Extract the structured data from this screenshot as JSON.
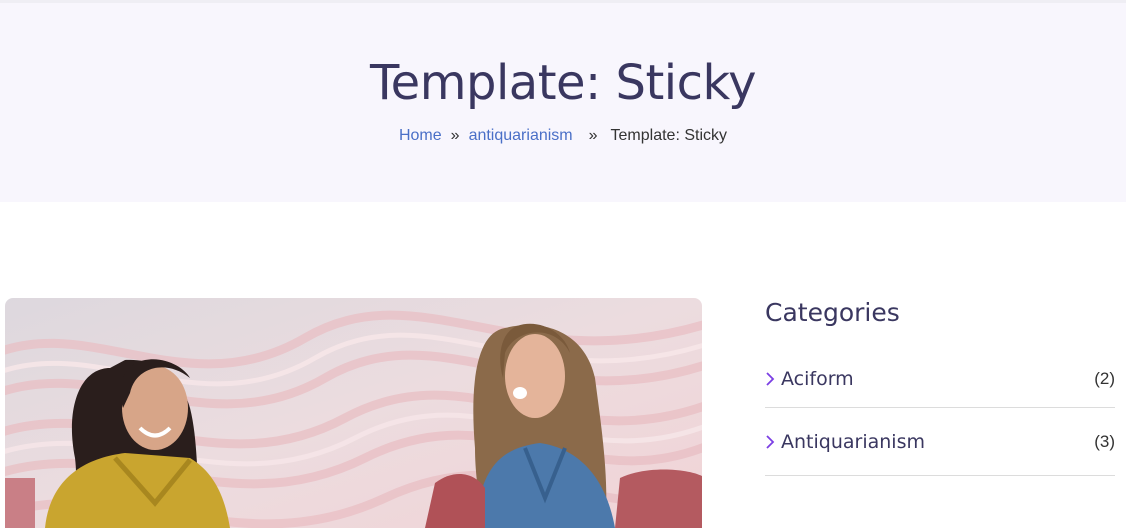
{
  "hero": {
    "title": "Template: Sticky",
    "breadcrumb": {
      "home": "Home",
      "sep": "»",
      "category": "antiquarianism",
      "current": "Template: Sticky"
    }
  },
  "sidebar": {
    "widget_title": "Categories",
    "categories": [
      {
        "name": "Aciform",
        "count": "(2)"
      },
      {
        "name": "Antiquarianism",
        "count": "(3)"
      }
    ]
  },
  "colors": {
    "hero_bg": "#f8f6fd",
    "heading": "#3a3760",
    "link": "#4a6fc7",
    "chevron": "#7b3fe4"
  },
  "icons": {
    "category_bullet": "chevron-right-icon"
  }
}
